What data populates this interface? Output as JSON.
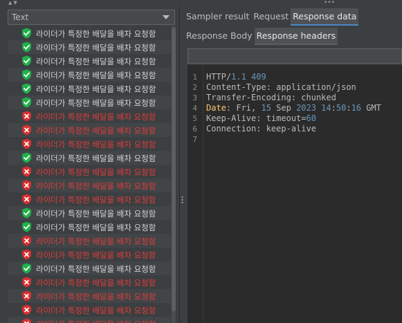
{
  "window": {
    "sort_arrows": "▲▼",
    "grip": "•••"
  },
  "left": {
    "renderer_combo": {
      "selected": "Text"
    },
    "results": [
      {
        "label": "라이더가 특정한 배달을 배차 요청함",
        "status": "success"
      },
      {
        "label": "라이더가 특정한 배달을 배차 요청함",
        "status": "success"
      },
      {
        "label": "라이더가 특정한 배달을 배차 요청함",
        "status": "success"
      },
      {
        "label": "라이더가 특정한 배달을 배차 요청함",
        "status": "success"
      },
      {
        "label": "라이더가 특정한 배달을 배차 요청함",
        "status": "success"
      },
      {
        "label": "라이더가 특정한 배달을 배차 요청함",
        "status": "success"
      },
      {
        "label": "라이더가 특정한 배달을 배차 요청함",
        "status": "fail"
      },
      {
        "label": "라이더가 특정한 배달을 배차 요청함",
        "status": "fail"
      },
      {
        "label": "라이더가 특정한 배달을 배차 요청함",
        "status": "fail"
      },
      {
        "label": "라이더가 특정한 배달을 배차 요청함",
        "status": "success"
      },
      {
        "label": "라이더가 특정한 배달을 배차 요청함",
        "status": "fail"
      },
      {
        "label": "라이더가 특정한 배달을 배차 요청함",
        "status": "fail"
      },
      {
        "label": "라이더가 특정한 배달을 배차 요청함",
        "status": "fail"
      },
      {
        "label": "라이더가 특정한 배달을 배차 요청함",
        "status": "success"
      },
      {
        "label": "라이더가 특정한 배달을 배차 요청함",
        "status": "success"
      },
      {
        "label": "라이더가 특정한 배달을 배차 요청함",
        "status": "fail"
      },
      {
        "label": "라이더가 특정한 배달을 배차 요청함",
        "status": "fail"
      },
      {
        "label": "라이더가 특정한 배달을 배차 요청함",
        "status": "success"
      },
      {
        "label": "라이더가 특정한 배달을 배차 요청함",
        "status": "fail"
      },
      {
        "label": "라이더가 특정한 배달을 배차 요청함",
        "status": "fail"
      },
      {
        "label": "라이더가 특정한 배달을 배차 요청함",
        "status": "fail"
      },
      {
        "label": "라이더가 특정한 배달을 배차 요청함",
        "status": "fail"
      }
    ]
  },
  "right": {
    "tabs": [
      {
        "label": "Sampler result",
        "active": false
      },
      {
        "label": "Request",
        "active": false
      },
      {
        "label": "Response data",
        "active": true
      }
    ],
    "subtabs": [
      {
        "label": "Response Body",
        "active": false
      },
      {
        "label": "Response headers",
        "active": true
      }
    ],
    "search": {
      "value": ""
    },
    "code_lines": [
      {
        "n": "1",
        "segments": [
          {
            "t": "HTTP/",
            "c": "plain"
          },
          {
            "t": "1.1",
            "c": "num"
          },
          {
            "t": " ",
            "c": "plain"
          },
          {
            "t": "409",
            "c": "num"
          }
        ]
      },
      {
        "n": "2",
        "segments": [
          {
            "t": "Content-Type: application/json",
            "c": "plain"
          }
        ]
      },
      {
        "n": "3",
        "segments": [
          {
            "t": "Transfer-Encoding: chunked",
            "c": "plain"
          }
        ]
      },
      {
        "n": "4",
        "segments": [
          {
            "t": "Date",
            "c": "hdr"
          },
          {
            "t": ": Fri, ",
            "c": "plain"
          },
          {
            "t": "15",
            "c": "num"
          },
          {
            "t": " Sep ",
            "c": "plain"
          },
          {
            "t": "2023",
            "c": "num"
          },
          {
            "t": " ",
            "c": "plain"
          },
          {
            "t": "14",
            "c": "num"
          },
          {
            "t": ":",
            "c": "plain"
          },
          {
            "t": "50",
            "c": "num"
          },
          {
            "t": ":",
            "c": "plain"
          },
          {
            "t": "16",
            "c": "num"
          },
          {
            "t": " GMT",
            "c": "plain"
          }
        ]
      },
      {
        "n": "5",
        "segments": [
          {
            "t": "Keep-Alive: timeout=",
            "c": "plain"
          },
          {
            "t": "60",
            "c": "num"
          }
        ]
      },
      {
        "n": "6",
        "segments": [
          {
            "t": "Connection: keep-alive",
            "c": "plain"
          }
        ]
      },
      {
        "n": "7",
        "segments": []
      }
    ]
  },
  "colors": {
    "success": "#21b04a",
    "fail": "#d62f2f",
    "tab_underline": "#4a88c7"
  },
  "icons": {
    "success": "shield-check-icon",
    "fail": "shield-x-icon"
  }
}
